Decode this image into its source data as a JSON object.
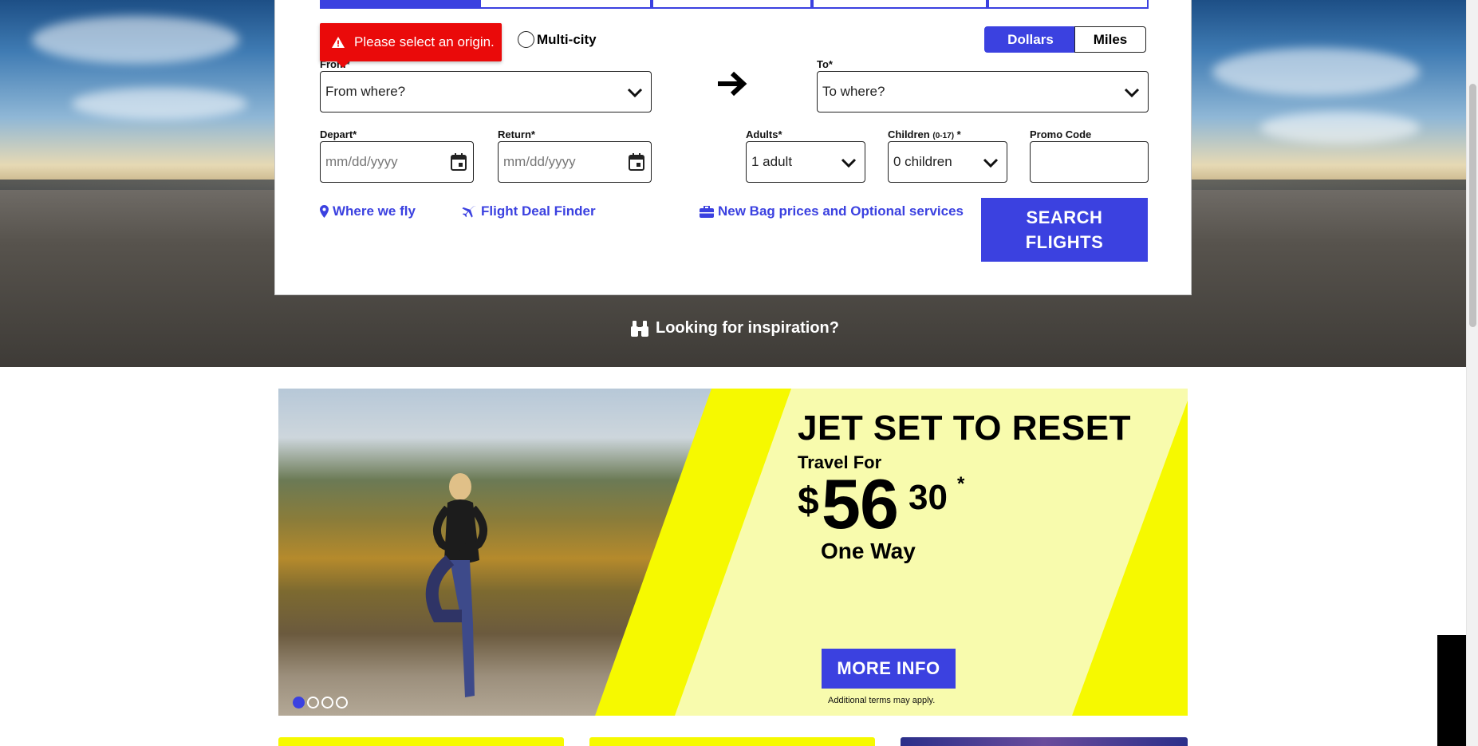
{
  "search_form": {
    "error_message": "Please select an origin.",
    "trip_type": {
      "multi_city_label": "Multi-city"
    },
    "currency_toggle": {
      "dollars_label": "Dollars",
      "miles_label": "Miles",
      "selected": "Dollars"
    },
    "from": {
      "label": "From*",
      "placeholder": "From where?"
    },
    "to": {
      "label": "To*",
      "placeholder": "To where?"
    },
    "depart": {
      "label": "Depart*",
      "placeholder": "mm/dd/yyyy"
    },
    "return": {
      "label": "Return*",
      "placeholder": "mm/dd/yyyy"
    },
    "adults": {
      "label": "Adults*",
      "value": "1 adult"
    },
    "children": {
      "label": "Children",
      "label_note": "(0-17)",
      "label_suffix": " *",
      "value": "0 children"
    },
    "promo": {
      "label": "Promo Code",
      "value": ""
    },
    "links": {
      "where_we_fly": "Where we fly",
      "deal_finder": "Flight Deal Finder",
      "bag_prices": "New Bag prices and Optional services"
    },
    "search_button": {
      "line1": "SEARCH",
      "line2": "FLIGHTS"
    }
  },
  "inspiration_link": "Looking for inspiration?",
  "promo_banner": {
    "title": "JET SET TO RESET",
    "subtitle": "Travel For",
    "price": {
      "currency": "$",
      "dollars": "56",
      "cents": "30",
      "asterisk": "*"
    },
    "fare_note": "One Way",
    "button_label": "MORE INFO",
    "terms": "Additional terms may apply.",
    "carousel": {
      "slide_count": 4,
      "active_index": 0
    }
  },
  "colors": {
    "accent_blue": "#3b41e0",
    "error_red": "#ea0a0a",
    "promo_yellow": "#f6f900",
    "promo_pale_yellow": "#f8fbad"
  }
}
